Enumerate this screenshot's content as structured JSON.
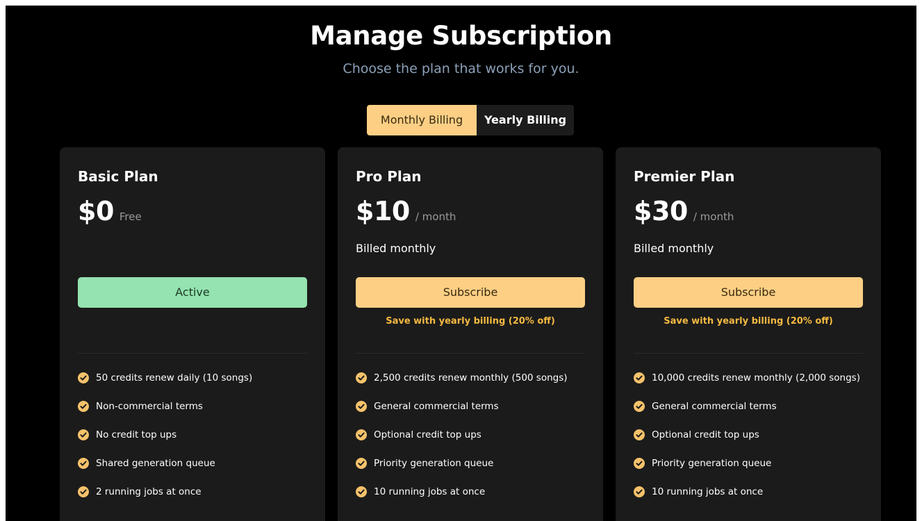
{
  "header": {
    "title": "Manage Subscription",
    "subtitle": "Choose the plan that works for you."
  },
  "billing_toggle": {
    "monthly_label": "Monthly Billing",
    "yearly_label": "Yearly Billing",
    "selected": "Monthly Billing"
  },
  "colors": {
    "accent": "#fccf84",
    "active": "#95e3b0",
    "save_text": "#f5b942",
    "card_bg": "#1b1b1b",
    "page_bg": "#000000"
  },
  "plans": [
    {
      "name": "Basic Plan",
      "price": "$0",
      "period": "Free",
      "billed": "",
      "button_label": "Active",
      "save_note": "",
      "features": [
        "50 credits renew daily (10 songs)",
        "Non-commercial terms",
        "No credit top ups",
        "Shared generation queue",
        "2 running jobs at once"
      ]
    },
    {
      "name": "Pro Plan",
      "price": "$10",
      "period": "/ month",
      "billed": "Billed monthly",
      "button_label": "Subscribe",
      "save_note": "Save with yearly billing (20% off)",
      "features": [
        "2,500 credits renew monthly (500 songs)",
        "General commercial terms",
        "Optional credit top ups",
        "Priority generation queue",
        "10 running jobs at once"
      ]
    },
    {
      "name": "Premier Plan",
      "price": "$30",
      "period": "/ month",
      "billed": "Billed monthly",
      "button_label": "Subscribe",
      "save_note": "Save with yearly billing (20% off)",
      "features": [
        "10,000 credits renew monthly (2,000 songs)",
        "General commercial terms",
        "Optional credit top ups",
        "Priority generation queue",
        "10 running jobs at once"
      ]
    }
  ],
  "icons": {
    "feature_check": "check-circle-icon"
  }
}
